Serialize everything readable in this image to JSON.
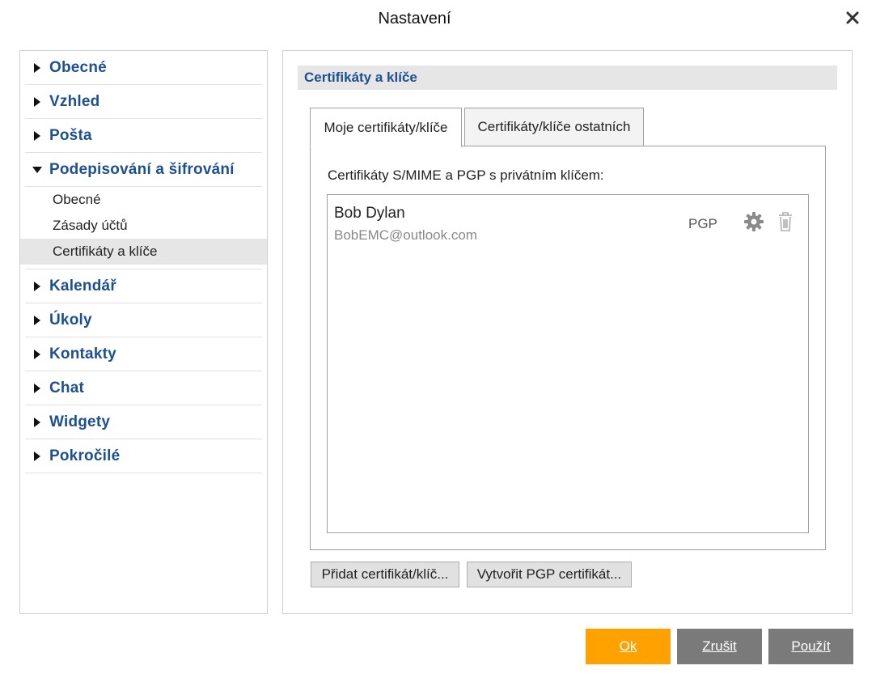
{
  "dialog": {
    "title": "Nastavení",
    "close_icon": "close-icon"
  },
  "sidebar": {
    "sections": [
      {
        "label": "Obecné"
      },
      {
        "label": "Vzhled"
      },
      {
        "label": "Pošta"
      },
      {
        "label": "Podepisování a šifrování",
        "expanded": true,
        "items": [
          {
            "label": "Obecné"
          },
          {
            "label": "Zásady účtů"
          },
          {
            "label": "Certifikáty a klíče",
            "selected": true
          }
        ]
      },
      {
        "label": "Kalendář"
      },
      {
        "label": "Úkoly"
      },
      {
        "label": "Kontakty"
      },
      {
        "label": "Chat"
      },
      {
        "label": "Widgety"
      },
      {
        "label": "Pokročilé"
      }
    ]
  },
  "main": {
    "section_title": "Certifikáty a klíče",
    "tabs": [
      {
        "label": "Moje certifikáty/klíče",
        "active": true
      },
      {
        "label": "Certifikáty/klíče ostatních"
      }
    ],
    "pane_caption": "Certifikáty S/MIME a PGP s privátním klíčem:",
    "certificates": [
      {
        "name": "Bob Dylan",
        "email": "BobEMC@outlook.com",
        "type": "PGP"
      }
    ],
    "add_button": "Přidat certifikát/klíč...",
    "create_button": "Vytvořit PGP certifikát..."
  },
  "footer": {
    "ok": "Ok",
    "cancel": "Zrušit",
    "apply": "Použít"
  },
  "colors": {
    "accent": "#ffa200",
    "nav_text": "#1d4f91",
    "secondary_button": "#7a7a7a",
    "selected_bg": "#e6e6e6"
  }
}
